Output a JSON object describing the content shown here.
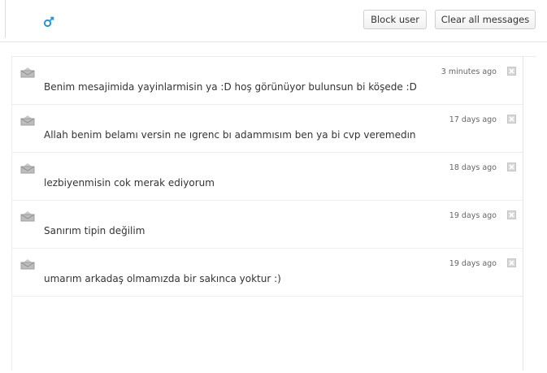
{
  "header": {
    "gender_icon": "male-symbol-icon",
    "block_user_label": "Block user",
    "clear_all_label": "Clear all messages"
  },
  "colors": {
    "accent": "#2a95d2"
  },
  "messages": [
    {
      "time": "3 minutes ago",
      "text": "Benim mesajimida yayinlarmisin ya :D hoş görünüyor bulunsun bi köşede :D",
      "icon": "envelope-icon"
    },
    {
      "time": "17 days ago",
      "text": "Allah benim belamı versin ne ıgrenc bı adammısım ben ya bi cvp veremedın",
      "icon": "envelope-icon"
    },
    {
      "time": "18 days ago",
      "text": "lezbiyenmisin cok merak ediyorum",
      "icon": "envelope-icon"
    },
    {
      "time": "19 days ago",
      "text": "Sanırım tipin değilim",
      "icon": "envelope-icon"
    },
    {
      "time": "19 days ago",
      "text": "umarım arkadaş olmamızda bir sakınca yoktur :)",
      "icon": "envelope-icon"
    }
  ]
}
